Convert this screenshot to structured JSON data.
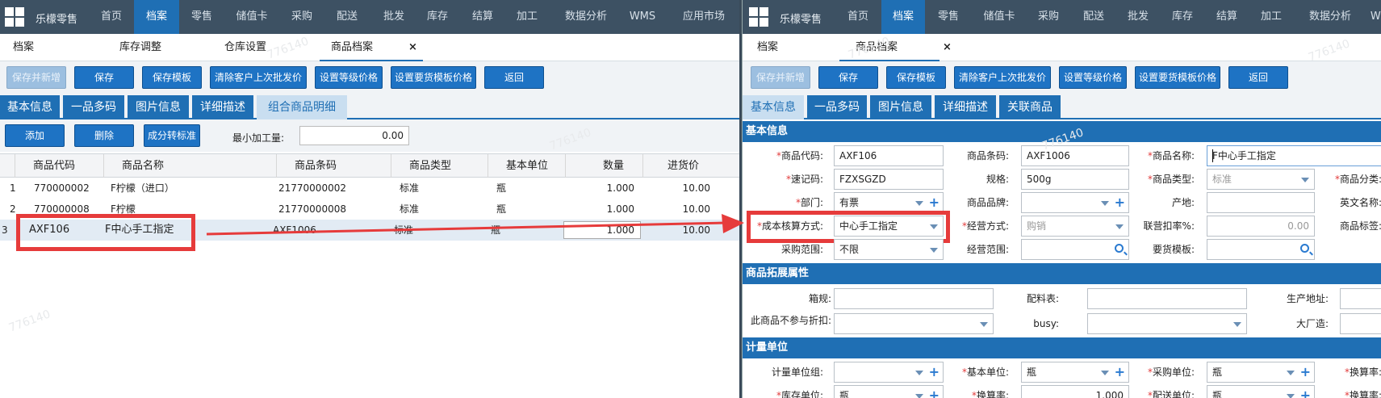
{
  "left": {
    "brand": "乐檬零售",
    "nav": [
      "首页",
      "档案",
      "零售",
      "储值卡",
      "采购",
      "配送",
      "批发",
      "库存",
      "结算",
      "加工",
      "数据分析",
      "WMS",
      "应用市场"
    ],
    "nav_active": "档案",
    "crumbs": [
      "档案",
      "库存调整",
      "仓库设置",
      "商品档案"
    ],
    "close_mark": "×",
    "toolbar": [
      "保存并新增",
      "保存",
      "保存模板",
      "清除客户上次批发价",
      "设置等级价格",
      "设置要货模板价格",
      "返回"
    ],
    "subtabs": [
      "基本信息",
      "一品多码",
      "图片信息",
      "详细描述",
      "组合商品明细"
    ],
    "grid_buttons": [
      "添加",
      "删除",
      "成分转标准"
    ],
    "min_label": "最小加工量:",
    "min_value": "0.00",
    "columns": [
      "商品代码",
      "商品名称",
      "商品条码",
      "商品类型",
      "基本单位",
      "数量",
      "进货价"
    ],
    "rows": [
      {
        "no": "1",
        "code": "770000002",
        "name": "F柠檬（进口）",
        "barcode": "21770000002",
        "type": "标准",
        "unit": "瓶",
        "qty": "1.000",
        "price": "10.00"
      },
      {
        "no": "2",
        "code": "770000008",
        "name": "F柠檬",
        "barcode": "21770000008",
        "type": "标准",
        "unit": "瓶",
        "qty": "1.000",
        "price": "10.00"
      },
      {
        "no": "3",
        "code": "AXF106",
        "name": "F中心手工指定",
        "barcode": "AXF1006",
        "type": "标准",
        "unit": "瓶",
        "qty": "1.000",
        "price": "10.00"
      }
    ]
  },
  "right": {
    "brand": "乐檬零售",
    "nav": [
      "首页",
      "档案",
      "零售",
      "储值卡",
      "采购",
      "配送",
      "批发",
      "库存",
      "结算",
      "加工",
      "数据分析",
      "WMS"
    ],
    "nav_active": "档案",
    "crumbs": [
      "档案",
      "商品档案"
    ],
    "close_mark": "×",
    "toolbar": [
      "保存并新增",
      "保存",
      "保存模板",
      "清除客户上次批发价",
      "设置等级价格",
      "设置要货模板价格",
      "返回"
    ],
    "subtabs": [
      "基本信息",
      "一品多码",
      "图片信息",
      "详细描述",
      "关联商品"
    ],
    "sections": {
      "basic": "基本信息",
      "ext": "商品拓展属性",
      "unit": "计量单位"
    },
    "basic": {
      "code_label": "商品代码:",
      "code": "AXF106",
      "barcode_label": "商品条码:",
      "barcode": "AXF1006",
      "name_label": "商品名称:",
      "name": "F中心手工指定",
      "quick_label": "速记码:",
      "quick": "FZXSGZD",
      "spec_label": "规格:",
      "spec": "500g",
      "type_label": "商品类型:",
      "type": "标准",
      "category_label": "商品分类:",
      "dept_label": "部门:",
      "dept": "有票",
      "brand_label": "商品品牌:",
      "origin_label": "产地:",
      "english_label": "英文名称:",
      "cost_label": "成本核算方式:",
      "cost": "中心手工指定",
      "biz_label": "经营方式:",
      "biz": "购销",
      "discount_label": "联营扣率%:",
      "discount": "0.00",
      "tag_label": "商品标签:",
      "purchase_scope_label": "采购范围:",
      "purchase_scope": "不限",
      "biz_scope_label": "经营范围:",
      "order_tpl_label": "要货模板:"
    },
    "ext": {
      "box_label": "箱规:",
      "recipe_label": "配料表:",
      "addr_label": "生产地址:",
      "nodiscount_label": "此商品不参与折扣:",
      "busy_label": "busy:",
      "factory_label": "大厂造:"
    },
    "unit": {
      "group_label": "计量单位组:",
      "base_label": "基本单位:",
      "base": "瓶",
      "purchase_label": "采购单位:",
      "purchase": "瓶",
      "rate_label": "换算率:",
      "stock_label": "库存单位:",
      "stock": "瓶",
      "rate2_label": "换算率:",
      "rate2": "1.000",
      "ship_label": "配送单位:",
      "ship": "瓶",
      "rate3_label": "换算率:"
    }
  },
  "watermark": "776140",
  "accent": "#1f6fb4",
  "highlight": "#e63b3b"
}
